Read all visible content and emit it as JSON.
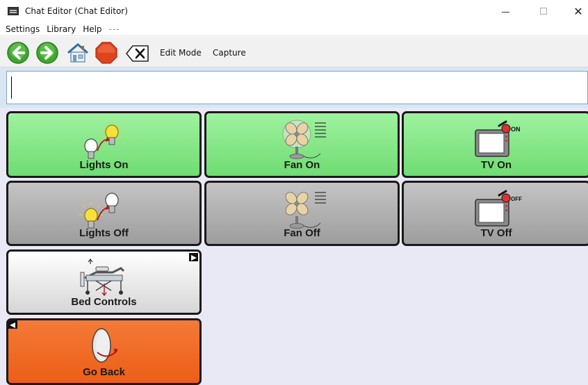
{
  "window": {
    "title": "Chat Editor (Chat Editor)",
    "close_glyph": "✕"
  },
  "menu": {
    "items": [
      "Settings",
      "Library",
      "Help"
    ],
    "more": "---"
  },
  "toolbar": {
    "edit_mode": "Edit Mode",
    "capture": "Capture",
    "icons": [
      "back-arrow-icon",
      "forward-arrow-icon",
      "home-icon",
      "stop-icon",
      "clear-icon"
    ]
  },
  "message": {
    "value": ""
  },
  "board": {
    "buttons": [
      {
        "label": "Lights On",
        "icon": "lights-on-icon",
        "color": "#7fe582"
      },
      {
        "label": "Fan On",
        "icon": "fan-on-icon",
        "color": "#7fe582"
      },
      {
        "label": "TV On",
        "icon": "tv-on-icon",
        "color": "#7fe582"
      },
      {
        "label": "Lights Off",
        "icon": "lights-off-icon",
        "color": "#b0b0b0"
      },
      {
        "label": "Fan Off",
        "icon": "fan-off-icon",
        "color": "#b0b0b0"
      },
      {
        "label": "TV Off",
        "icon": "tv-off-icon",
        "color": "#b0b0b0"
      },
      {
        "label": "Bed Controls",
        "icon": "hospital-bed-icon",
        "color": "#eeeeee"
      },
      {
        "label": "Go Back",
        "icon": "go-back-icon",
        "color": "#f06a26"
      }
    ],
    "tv_on_badge": "ON",
    "tv_off_badge": "OFF"
  },
  "colors": {
    "green": "#7fe582",
    "gray": "#b0b0b0",
    "orange": "#f06a26",
    "board_background": "#e9e9f6"
  }
}
